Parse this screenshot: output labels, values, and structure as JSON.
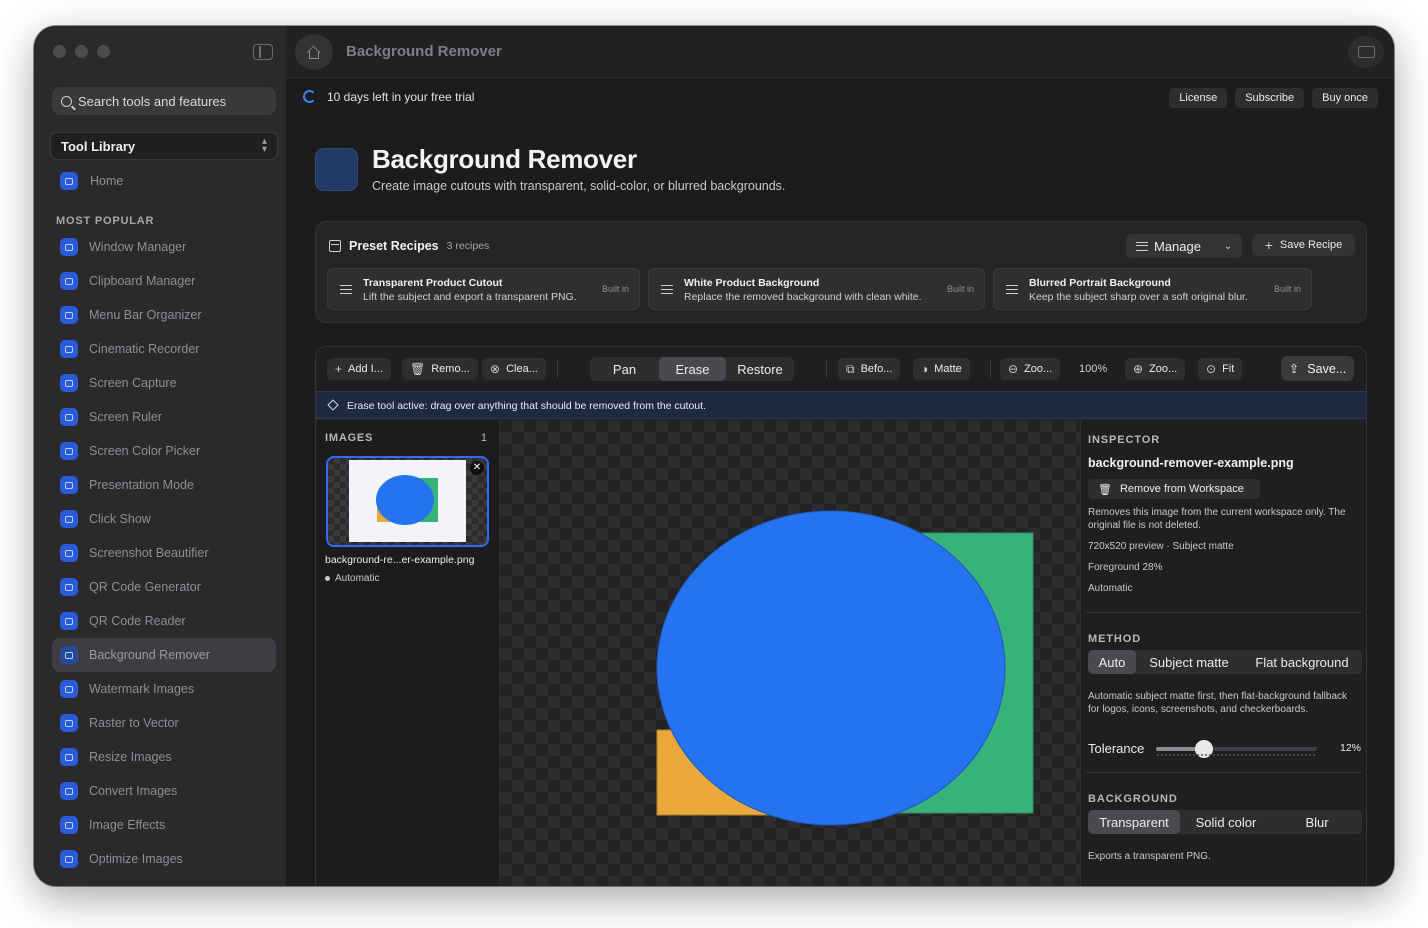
{
  "sidebar": {
    "search_placeholder": "Search tools and features",
    "library_select": "Tool Library",
    "home_label": "Home",
    "section_label": "MOST POPULAR",
    "items": [
      {
        "label": "Window Manager",
        "icon": "window-icon"
      },
      {
        "label": "Clipboard Manager",
        "icon": "clipboard-icon"
      },
      {
        "label": "Menu Bar Organizer",
        "icon": "menubar-icon"
      },
      {
        "label": "Cinematic Recorder",
        "icon": "record-icon"
      },
      {
        "label": "Screen Capture",
        "icon": "capture-icon"
      },
      {
        "label": "Screen Ruler",
        "icon": "ruler-icon"
      },
      {
        "label": "Screen Color Picker",
        "icon": "eyedropper-icon"
      },
      {
        "label": "Presentation Mode",
        "icon": "presentation-icon"
      },
      {
        "label": "Click Show",
        "icon": "click-icon"
      },
      {
        "label": "Screenshot Beautifier",
        "icon": "beautify-icon"
      },
      {
        "label": "QR Code Generator",
        "icon": "qr-icon"
      },
      {
        "label": "QR Code Reader",
        "icon": "qr-scan-icon"
      },
      {
        "label": "Background Remover",
        "icon": "background-remover-icon",
        "active": true
      },
      {
        "label": "Watermark Images",
        "icon": "watermark-icon"
      },
      {
        "label": "Raster to Vector",
        "icon": "vector-icon"
      },
      {
        "label": "Resize Images",
        "icon": "resize-icon"
      },
      {
        "label": "Convert Images",
        "icon": "convert-icon"
      },
      {
        "label": "Image Effects",
        "icon": "effects-icon"
      },
      {
        "label": "Optimize Images",
        "icon": "optimize-icon"
      }
    ]
  },
  "titlebar": {
    "title": "Background Remover"
  },
  "trial": {
    "text": "10 days left in your free trial",
    "buttons": [
      "License",
      "Subscribe",
      "Buy once"
    ]
  },
  "hero": {
    "title": "Background Remover",
    "subtitle": "Create image cutouts with transparent, solid-color, or blurred backgrounds."
  },
  "recipes": {
    "title": "Preset Recipes",
    "count": "3 recipes",
    "manage_label": "Manage",
    "save_label": "Save Recipe",
    "items": [
      {
        "title": "Transparent Product Cutout",
        "desc": "Lift the subject and export a transparent PNG.",
        "badge": "Built in"
      },
      {
        "title": "White Product Background",
        "desc": "Replace the removed background with clean white.",
        "badge": "Built in"
      },
      {
        "title": "Blurred Portrait Background",
        "desc": "Keep the subject sharp over a soft original blur.",
        "badge": "Built in"
      }
    ]
  },
  "toolbar": {
    "add": "Add I...",
    "remove": "Remo...",
    "clear": "Clea...",
    "modes": [
      "Pan",
      "Erase",
      "Restore"
    ],
    "active_mode": "Erase",
    "before": "Befo...",
    "matte": "Matte",
    "zoom_out": "Zoo...",
    "zoom_pct": "100%",
    "zoom_in": "Zoo...",
    "fit": "Fit",
    "save": "Save..."
  },
  "infobar": {
    "text": "Erase tool active: drag over anything that should be removed from the cutout."
  },
  "images": {
    "header": "IMAGES",
    "count": "1",
    "file_name": "background-re...er-example.png",
    "mode": "Automatic"
  },
  "inspector": {
    "header": "INSPECTOR",
    "file": "background-remover-example.png",
    "remove_label": "Remove from Workspace",
    "note1": "Removes this image from the current workspace only. The original file is not deleted.",
    "meta1": "720x520 preview · Subject matte",
    "meta2": "Foreground 28%",
    "meta3": "Automatic",
    "method_header": "METHOD",
    "methods": [
      "Auto",
      "Subject matte",
      "Flat background"
    ],
    "method_active": "Auto",
    "method_note": "Automatic subject matte first, then flat-background fallback for logos, icons, screenshots, and checkerboards.",
    "tolerance_label": "Tolerance",
    "tolerance_value": "12%",
    "tolerance": 0.3,
    "background_header": "BACKGROUND",
    "backgrounds": [
      "Transparent",
      "Solid color",
      "Blur"
    ],
    "background_active": "Transparent",
    "background_note": "Exports a transparent PNG."
  },
  "colors": {
    "accent": "#2f6df0",
    "circle": "#2673f0",
    "square": "#37b37a",
    "orange": "#e8a93a"
  }
}
